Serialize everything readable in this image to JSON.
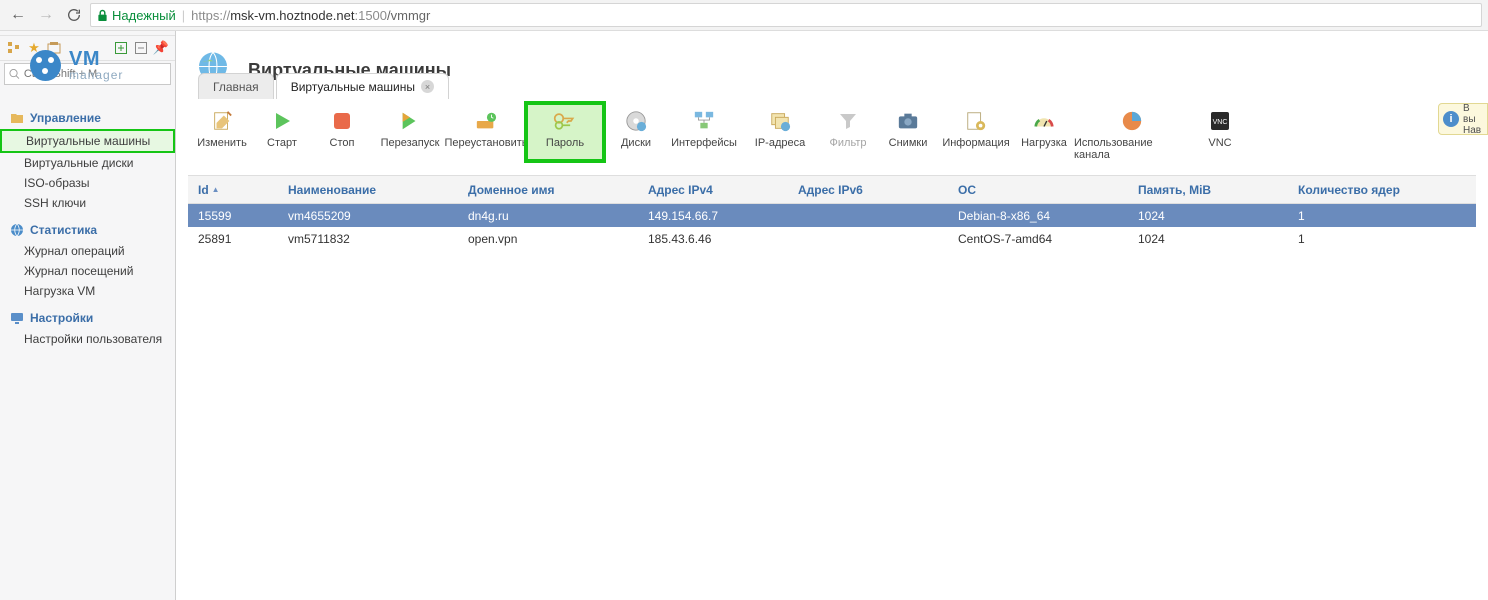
{
  "browser": {
    "secure_label": "Надежный",
    "url_scheme": "https://",
    "url_host": "msk-vm.hoztnode.net",
    "url_port": ":1500",
    "url_path": "/vmmgr"
  },
  "logo": {
    "vm": "VM",
    "mgr": "manager"
  },
  "tabs": [
    {
      "label": "Главная",
      "close": false,
      "active": false
    },
    {
      "label": "Виртуальные машины",
      "close": true,
      "active": true
    }
  ],
  "hint": {
    "line1": "В вы",
    "line2": "Нав"
  },
  "search_placeholder": "Ctrl + Shift + M",
  "sidebar": {
    "mgmt": {
      "title": "Управление",
      "items": [
        "Виртуальные машины",
        "Виртуальные диски",
        "ISO-образы",
        "SSH ключи"
      ]
    },
    "stat": {
      "title": "Статистика",
      "items": [
        "Журнал операций",
        "Журнал посещений",
        "Нагрузка VM"
      ]
    },
    "settings": {
      "title": "Настройки",
      "items": [
        "Настройки пользователя"
      ]
    }
  },
  "page_title": "Виртуальные машины",
  "toolbar": {
    "edit": "Изменить",
    "start": "Старт",
    "stop": "Стоп",
    "restart": "Перезапуск",
    "reinstall": "Переустановить",
    "password": "Пароль",
    "disks": "Диски",
    "ifaces": "Интерфейсы",
    "ips": "IP-адреса",
    "filter": "Фильтр",
    "snaps": "Снимки",
    "info": "Информация",
    "load": "Нагрузка",
    "channel": "Использование канала",
    "vnc": "VNC"
  },
  "columns": [
    "Id",
    "Наименование",
    "Доменное имя",
    "Адрес IPv4",
    "Адрес IPv6",
    "OC",
    "Память, MiB",
    "Количество ядер"
  ],
  "rows": [
    {
      "id": "15599",
      "name": "vm4655209",
      "domain": "dn4g.ru",
      "ipv4": "149.154.66.7",
      "ipv6": "",
      "os": "Debian-8-x86_64",
      "mem": "1024",
      "cores": "1",
      "sel": true
    },
    {
      "id": "25891",
      "name": "vm5711832",
      "domain": "open.vpn",
      "ipv4": "185.43.6.46",
      "ipv6": "",
      "os": "CentOS-7-amd64",
      "mem": "1024",
      "cores": "1",
      "sel": false
    }
  ]
}
